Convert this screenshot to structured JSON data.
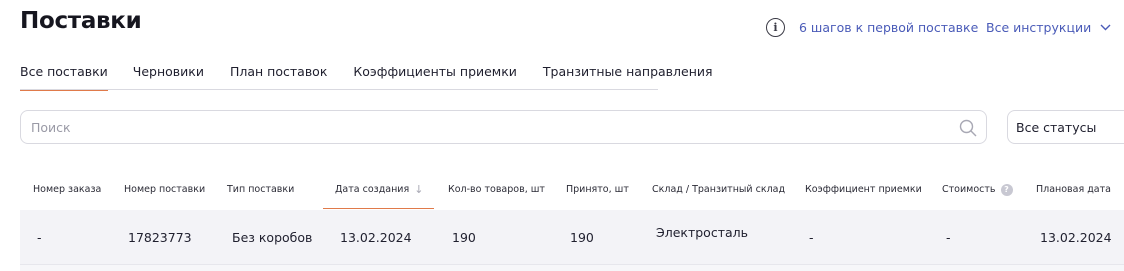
{
  "page": {
    "title": "Поставки"
  },
  "header": {
    "info_icon_glyph": "i",
    "guide_link": "6 шагов к первой поставке",
    "instructions_link": "Все инструкции"
  },
  "tabs": [
    {
      "label": "Все поставки",
      "active": true
    },
    {
      "label": "Черновики",
      "active": false
    },
    {
      "label": "План поставок",
      "active": false
    },
    {
      "label": "Коэффициенты приемки",
      "active": false
    },
    {
      "label": "Транзитные направления",
      "active": false
    }
  ],
  "search": {
    "placeholder": "Поиск",
    "value": ""
  },
  "status_filter": {
    "selected": "Все статусы"
  },
  "table": {
    "columns": [
      {
        "label": "Номер заказа"
      },
      {
        "label": "Номер поставки"
      },
      {
        "label": "Тип поставки"
      },
      {
        "label": "Дата создания",
        "sorted": "desc"
      },
      {
        "label": "Кол-во товаров, шт"
      },
      {
        "label": "Принято, шт"
      },
      {
        "label": "Склад / Транзитный склад"
      },
      {
        "label": "Коэффициент приемки"
      },
      {
        "label": "Стоимость",
        "help": "?"
      },
      {
        "label": "Плановая дата"
      }
    ],
    "rows": [
      {
        "order_number": "-",
        "supply_number": "17823773",
        "supply_type": "Без коробов",
        "created_date": "13.02.2024",
        "items_count": "190",
        "accepted": "190",
        "warehouse": "Электросталь",
        "acceptance_coef": "-",
        "cost": "-",
        "planned_date": "13.02.2024"
      }
    ]
  },
  "colors": {
    "accent_underline": "#e07a4a",
    "link": "#4a5bb8",
    "row_background": "#f3f3f7",
    "border": "#d9d9e0"
  }
}
